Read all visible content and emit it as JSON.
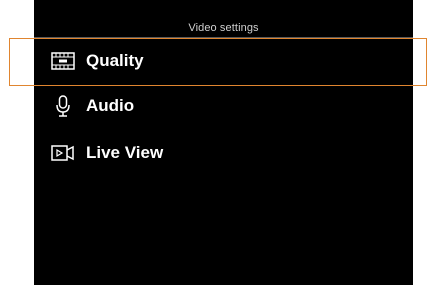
{
  "screen": {
    "title": "Video settings"
  },
  "menu": {
    "items": [
      {
        "label": "Quality",
        "icon": "film-strip-icon",
        "selected": true
      },
      {
        "label": "Audio",
        "icon": "microphone-icon",
        "selected": false
      },
      {
        "label": "Live View",
        "icon": "live-view-icon",
        "selected": false
      }
    ]
  },
  "colors": {
    "background": "#000000",
    "text": "#ffffff",
    "focus_border": "#e0852f"
  }
}
